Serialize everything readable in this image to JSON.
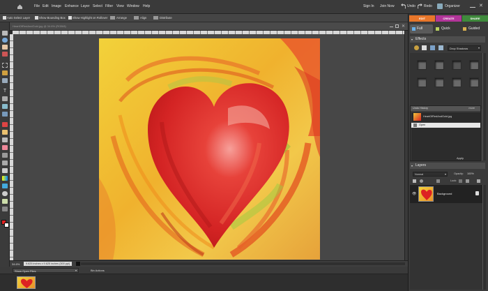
{
  "menubar": {
    "items": [
      "File",
      "Edit",
      "Image",
      "Enhance",
      "Layer",
      "Select",
      "Filter",
      "View",
      "Window",
      "Help"
    ],
    "sign_in": "Sign In",
    "join_now": "Join Now",
    "undo": "Undo",
    "redo": "Redo",
    "organizer": "Organizer"
  },
  "options": {
    "auto_select": "Auto Select Layer",
    "bounding_box": "Show Bounding Box",
    "highlight": "Show Highlight on Rollover",
    "arrange": "Arrange",
    "align": "Align",
    "distribute": "Distribute"
  },
  "document": {
    "tab_title": "HeartOfRedAndGold.jpg @ 34.6% (RGB/8)",
    "zoom": "34.6%",
    "dimensions": "9.625 inches x 9.625 inches (300 ppi)"
  },
  "bin": {
    "dropdown": "Show Open Files",
    "actions": "Bin Actions"
  },
  "panel": {
    "modes": {
      "edit": "EDIT",
      "create": "CREATE",
      "share": "SHARE"
    },
    "subtabs": {
      "full": "Full",
      "quick": "Quick",
      "guided": "Guided"
    },
    "effects": {
      "title": "Effects",
      "dropdown": "Drop Shadows"
    },
    "undo_history": {
      "title": "Undo History",
      "more": "more",
      "items": [
        "HeartOfRedAndGold.jpg",
        "Open"
      ]
    },
    "apply": "Apply",
    "layers": {
      "title": "Layers",
      "blend_mode": "Normal",
      "opacity_label": "Opacity:",
      "opacity_value": "100%",
      "lock_label": "Lock:",
      "layer_name": "Background"
    }
  },
  "colors": {
    "accent_edit": "#e8762a",
    "accent_create": "#b3359a",
    "accent_share": "#3f8a3c",
    "foreground": "#e02020",
    "background": "#ffffff"
  }
}
